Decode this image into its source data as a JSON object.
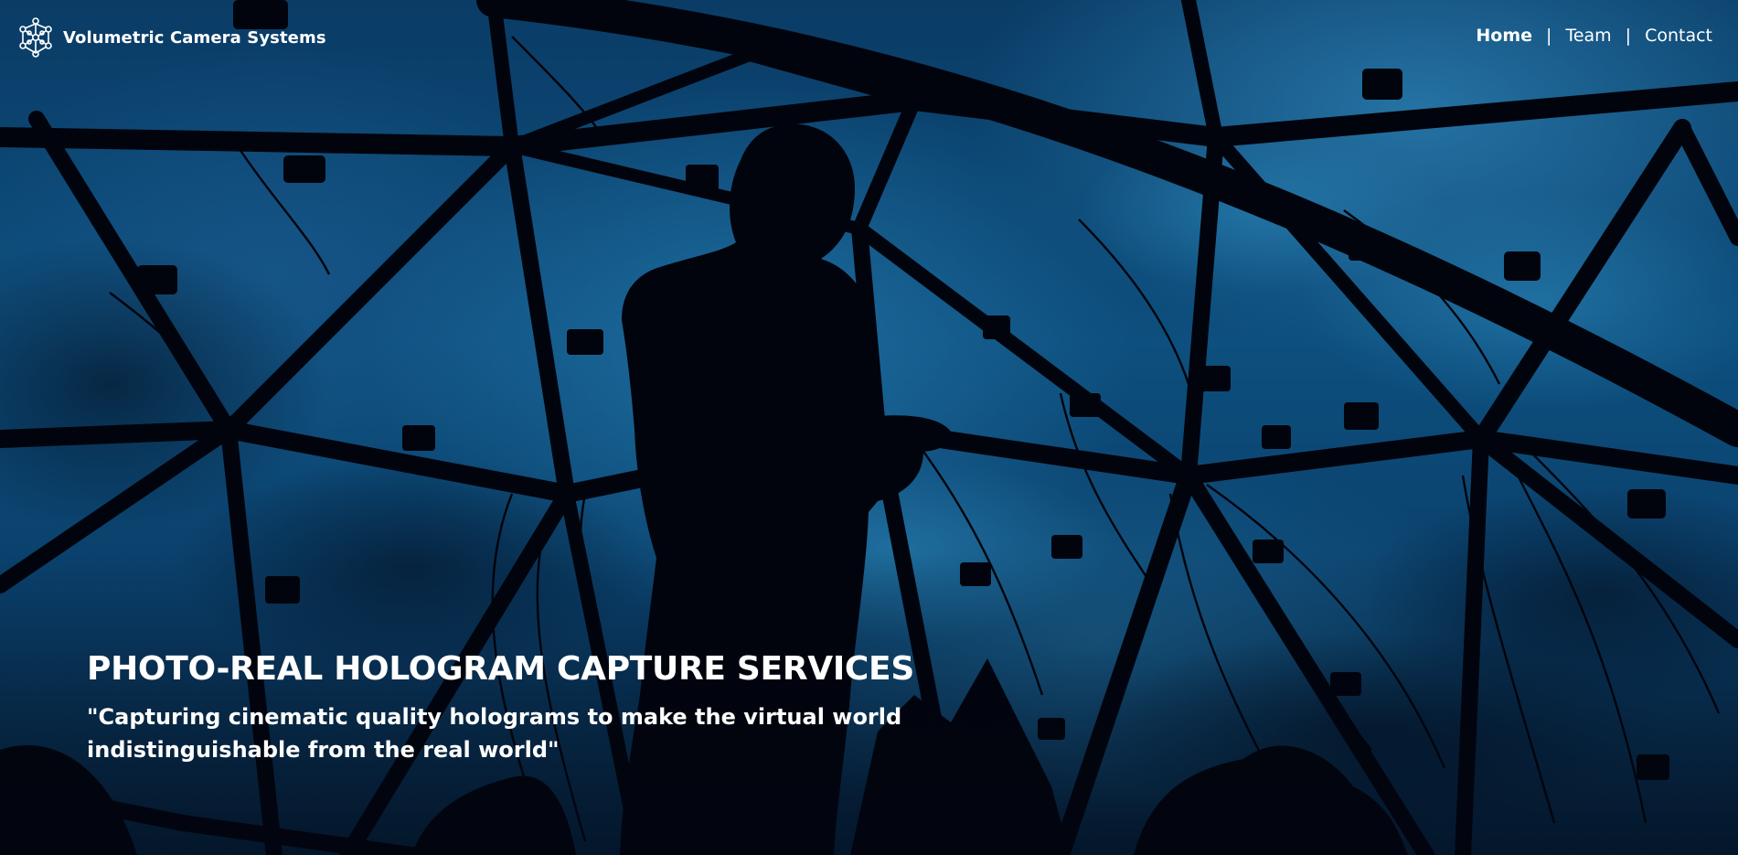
{
  "brand": {
    "name": "Volumetric Camera Systems",
    "logo_icon": "molecule-network-icon"
  },
  "nav": {
    "items": [
      {
        "label": "Home",
        "active": true
      },
      {
        "label": "Team",
        "active": false
      },
      {
        "label": "Contact",
        "active": false
      }
    ],
    "separator": "|"
  },
  "hero": {
    "headline": "PHOTO-REAL HOLOGRAM CAPTURE SERVICES",
    "tagline": "\"Capturing cinematic quality holograms to make the virtual world indistinguishable from the real world\"",
    "background_image": "silhouette-person-geodesic-camera-dome-photo"
  },
  "colors": {
    "sky_blue": "#0d4f7e",
    "silhouette": "#020612",
    "text": "#ffffff"
  }
}
